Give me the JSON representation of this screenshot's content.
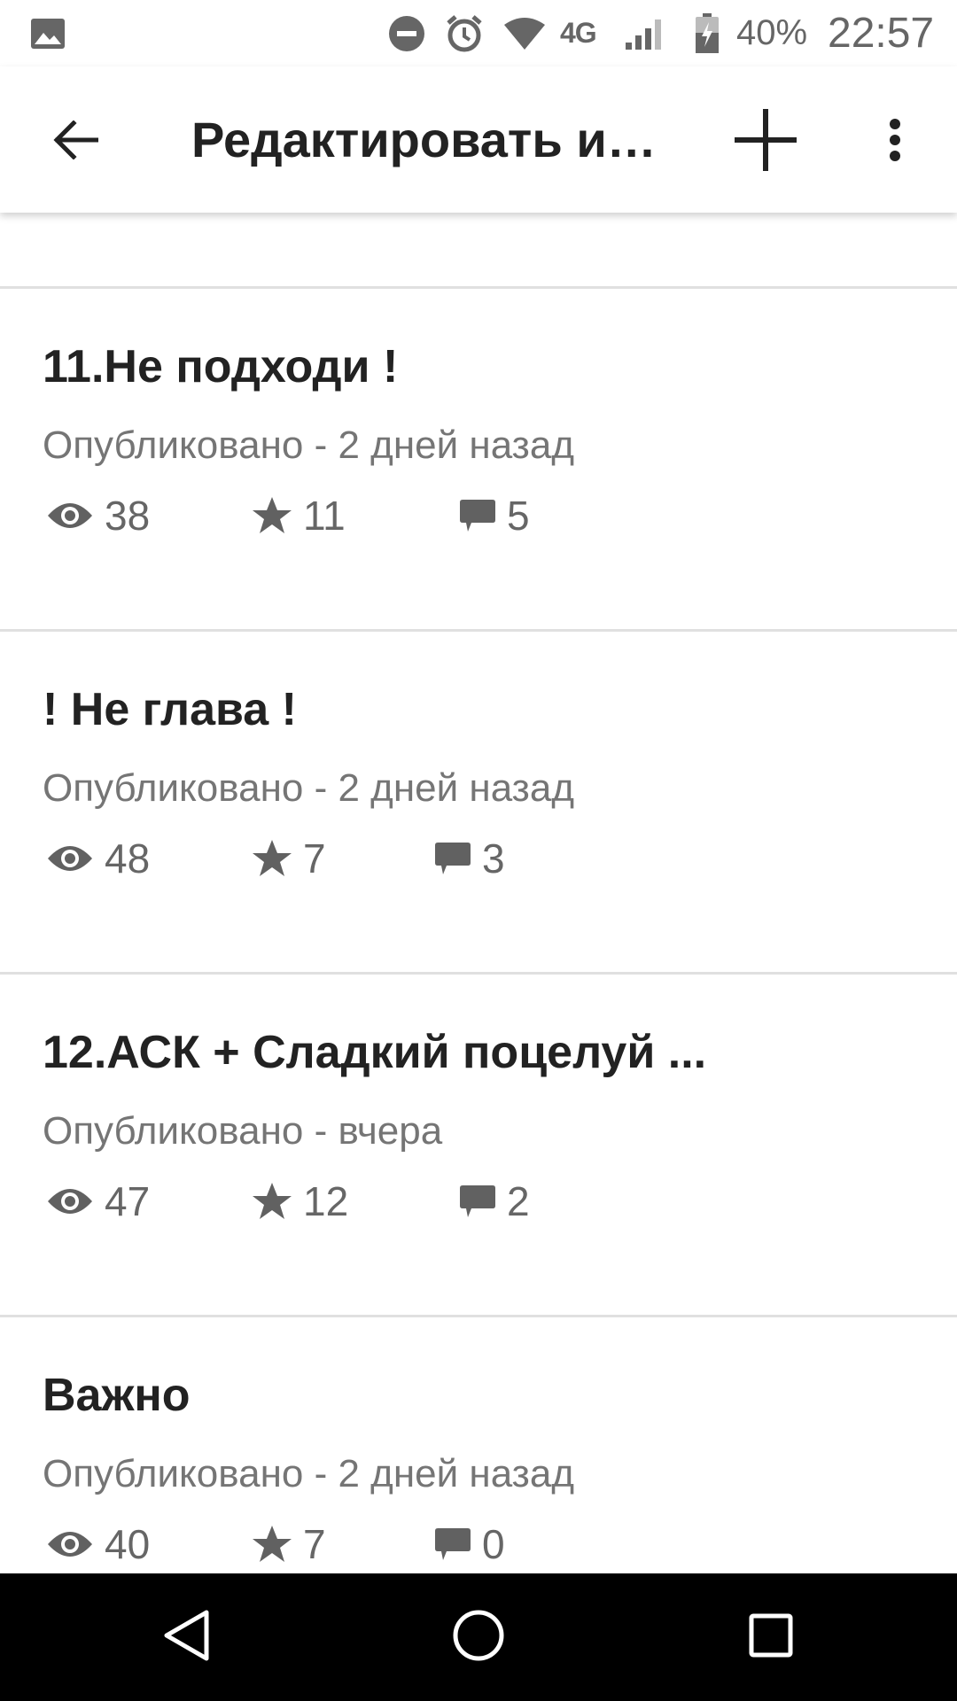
{
  "status_bar": {
    "network": "4G",
    "battery": "40%",
    "time": "22:57",
    "icons": [
      "gallery-icon",
      "dnd-icon",
      "alarm-icon",
      "wifi-icon",
      "signal-icon",
      "battery-icon"
    ]
  },
  "app_bar": {
    "title": "Редактировать и…",
    "icons": [
      "back-arrow-icon",
      "plus-icon",
      "more-vert-icon"
    ]
  },
  "parts": [
    {
      "title": "11.Не подходи !",
      "published": "Опубликовано - 2 дней назад",
      "views": "38",
      "votes": "11",
      "comments": "5"
    },
    {
      "title": "! Не глава !",
      "published": "Опубликовано - 2 дней назад",
      "views": "48",
      "votes": "7",
      "comments": "3"
    },
    {
      "title": "12.АСК + Сладкий поцелуй ...",
      "published": "Опубликовано - вчера",
      "views": "47",
      "votes": "12",
      "comments": "2"
    },
    {
      "title": "Важно",
      "published": "Опубликовано - 2 дней назад",
      "views": "40",
      "votes": "7",
      "comments": "0"
    }
  ],
  "stat_icons": {
    "views": "eye-icon",
    "votes": "star-icon",
    "comments": "comment-icon"
  },
  "nav_bar": {
    "icons": [
      "nav-back-icon",
      "nav-home-icon",
      "nav-recents-icon"
    ]
  },
  "colors": {
    "text_primary": "#222222",
    "text_secondary": "#757575",
    "icon_gray": "#616161",
    "divider": "#e0e0e0"
  }
}
